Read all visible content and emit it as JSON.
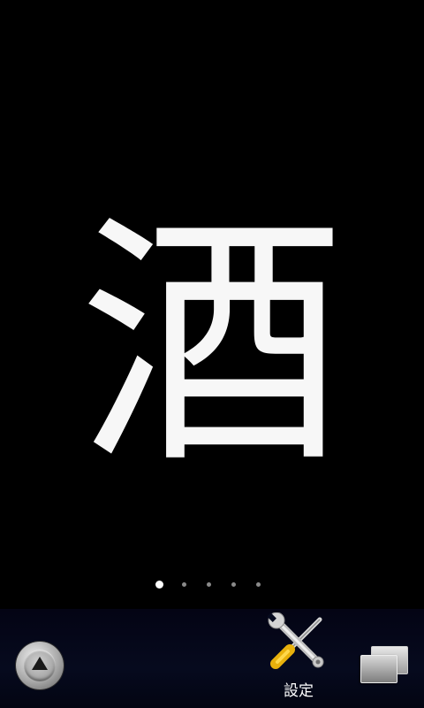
{
  "main": {
    "kanji": "酒",
    "pages": {
      "count": 5,
      "current": 1
    }
  },
  "dock": {
    "settings_label": "設定",
    "icons": {
      "launcher": "launcher-triangle-icon",
      "settings": "wrench-screwdriver-icon",
      "switcher": "stacked-windows-icon"
    }
  },
  "colors": {
    "background": "#000000",
    "kanji": "#f7f7f7",
    "dock": "#060a1e",
    "dot_active": "#ffffff",
    "dot_inactive": "#8a8a8a"
  }
}
